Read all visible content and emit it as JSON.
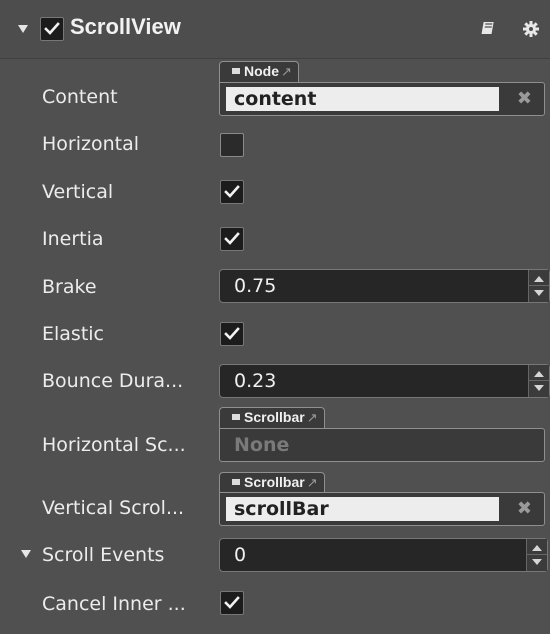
{
  "component": {
    "title": "ScrollView",
    "enabled": true,
    "help_icon": "book-icon",
    "settings_icon": "gear-icon"
  },
  "properties": {
    "content": {
      "label": "Content",
      "type_tag": "Node",
      "value": "content"
    },
    "horizontal": {
      "label": "Horizontal",
      "checked": false
    },
    "vertical": {
      "label": "Vertical",
      "checked": true
    },
    "inertia": {
      "label": "Inertia",
      "checked": true
    },
    "brake": {
      "label": "Brake",
      "value": "0.75"
    },
    "elastic": {
      "label": "Elastic",
      "checked": true
    },
    "bounce_duration": {
      "label": "Bounce Dura...",
      "value": "0.23"
    },
    "horizontal_scrollbar": {
      "label": "Horizontal Sc...",
      "type_tag": "Scrollbar",
      "value": "None"
    },
    "vertical_scrollbar": {
      "label": "Vertical Scrol...",
      "type_tag": "Scrollbar",
      "value": "scrollBar"
    },
    "scroll_events": {
      "label": "Scroll Events",
      "value": "0"
    },
    "cancel_inner_events": {
      "label": "Cancel Inner ...",
      "checked": true
    }
  },
  "icons": {
    "clear": "✖",
    "external_link": "↗"
  }
}
